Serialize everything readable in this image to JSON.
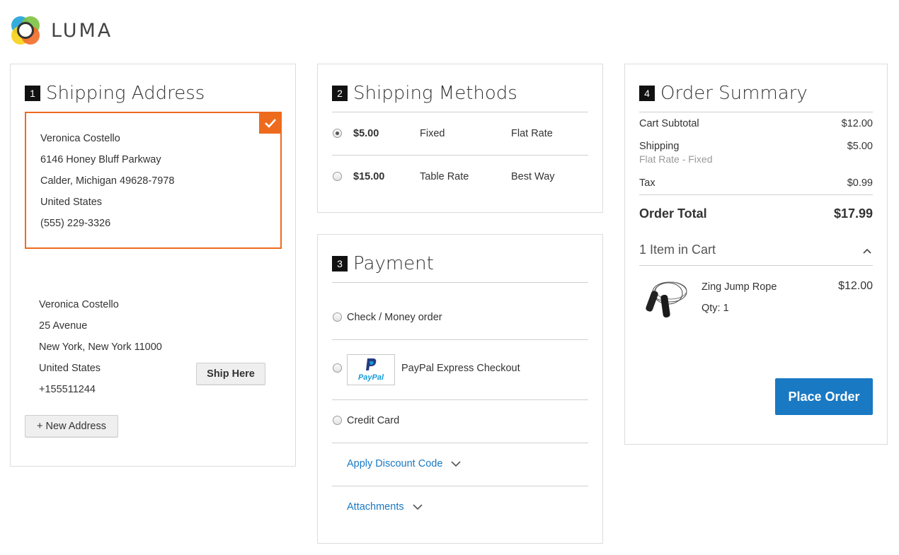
{
  "brand": {
    "name": "LUMA",
    "accent": "#ee6b1e",
    "link_color": "#1979c3"
  },
  "shipping_address": {
    "step": "1",
    "title": "Shipping Address",
    "selected": {
      "name": "Veronica Costello",
      "street": "6146 Honey Bluff Parkway",
      "city_line": "Calder, Michigan 49628-7978",
      "country": "United States",
      "phone": "(555) 229-3326"
    },
    "other": {
      "name": "Veronica Costello",
      "street": "25 Avenue",
      "city_line": "New York, New York 11000",
      "country": "United States",
      "phone": "+155511244",
      "ship_here_label": "Ship Here"
    },
    "new_address_label": "+ New Address"
  },
  "shipping_methods": {
    "step": "2",
    "title": "Shipping Methods",
    "rows": [
      {
        "price": "$5.00",
        "method": "Fixed",
        "carrier": "Flat Rate",
        "selected": true
      },
      {
        "price": "$15.00",
        "method": "Table Rate",
        "carrier": "Best Way",
        "selected": false
      }
    ]
  },
  "payment": {
    "step": "3",
    "title": "Payment",
    "options": [
      {
        "label": "Check / Money order",
        "selected": false
      },
      {
        "label": "PayPal Express Checkout",
        "selected": false,
        "logo_text": "PayPal"
      },
      {
        "label": "Credit Card",
        "selected": false
      }
    ],
    "discount_label": "Apply Discount Code",
    "attachments_label": "Attachments"
  },
  "order_summary": {
    "step": "4",
    "title": "Order Summary",
    "subtotal_label": "Cart Subtotal",
    "subtotal_value": "$12.00",
    "shipping_label": "Shipping",
    "shipping_value": "$5.00",
    "shipping_detail": "Flat Rate - Fixed",
    "tax_label": "Tax",
    "tax_value": "$0.99",
    "total_label": "Order Total",
    "total_value": "$17.99",
    "items_in_cart": "1 Item in Cart",
    "item": {
      "name": "Zing Jump Rope",
      "qty": "Qty: 1",
      "price": "$12.00"
    },
    "place_order_label": "Place Order"
  }
}
